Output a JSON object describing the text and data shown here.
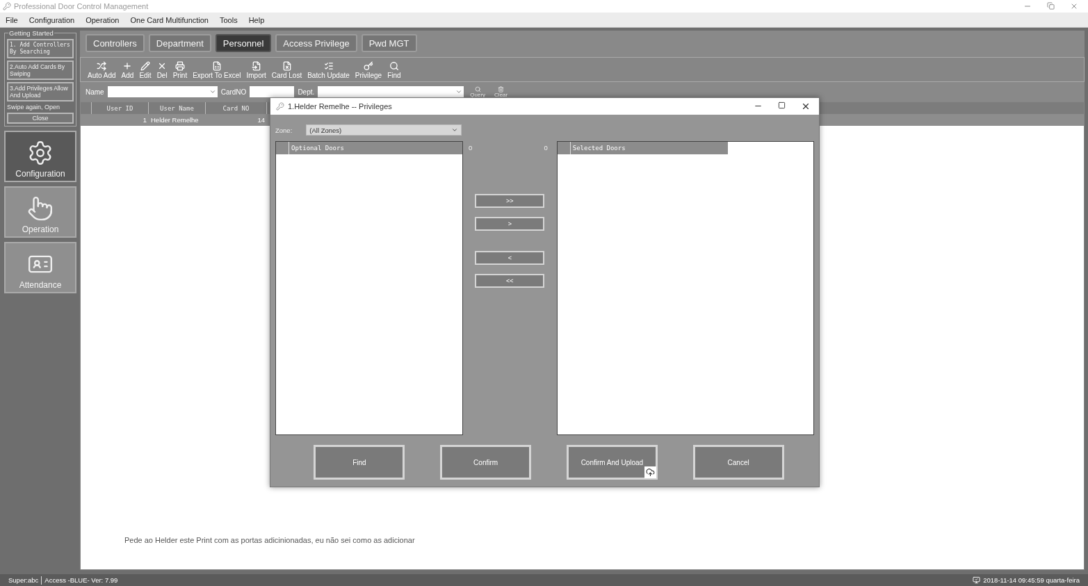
{
  "window": {
    "title": "Professional Door Control Management"
  },
  "menu": [
    "File",
    "Configuration",
    "Operation",
    "One Card Multifunction",
    "Tools",
    "Help"
  ],
  "getting_started": {
    "title": "Getting Started",
    "steps": [
      "1. Add Controllers By Searching",
      "2.Auto Add Cards By Swiping",
      "3.Add Privileges Allow And Upload"
    ],
    "note": "Swipe again, Open",
    "close": "Close"
  },
  "nav": [
    {
      "label": "Configuration",
      "kind": "gear",
      "selected": true
    },
    {
      "label": "Operation",
      "kind": "hand",
      "selected": false
    },
    {
      "label": "Attendance",
      "kind": "badge",
      "selected": false
    }
  ],
  "tabs": [
    {
      "label": "Controllers",
      "selected": false
    },
    {
      "label": "Department",
      "selected": false
    },
    {
      "label": "Personnel",
      "selected": true
    },
    {
      "label": "Access Privilege",
      "selected": false
    },
    {
      "label": "Pwd MGT",
      "selected": false
    }
  ],
  "toolbar": [
    {
      "label": "Auto Add",
      "kind": "auto"
    },
    {
      "label": "Add",
      "kind": "add"
    },
    {
      "label": "Edit",
      "kind": "edit"
    },
    {
      "label": "Del",
      "kind": "delete"
    },
    {
      "label": "Print",
      "kind": "print"
    },
    {
      "label": "Export To Excel",
      "kind": "excel"
    },
    {
      "label": "Import",
      "kind": "import"
    },
    {
      "label": "Card Lost",
      "kind": "lost"
    },
    {
      "label": "Batch Update",
      "kind": "batch"
    },
    {
      "label": "Privilege",
      "kind": "privilege"
    },
    {
      "label": "Find",
      "kind": "find"
    }
  ],
  "filter": {
    "name_label": "Name",
    "cardno_label": "CardNO",
    "dept_label": "Dept.",
    "query": "Query",
    "clear": "Clear"
  },
  "table": {
    "columns": [
      "User ID",
      "User Name",
      "Card NO"
    ],
    "rows": [
      {
        "cells": [
          "1",
          "Helder Remelhe",
          "14"
        ],
        "selected": true
      }
    ]
  },
  "note": "Pede ao Helder este Print com as portas adicinionadas, eu não sei como as adicionar",
  "dialog": {
    "title": "1.Helder Remelhe -- Privileges",
    "zone_label": "Zone:",
    "zone_value": "(All Zones)",
    "optional_header": "Optional Doors",
    "optional_count": "0",
    "selected_count": "0",
    "selected_header": "Selected Doors",
    "move_buttons": [
      ">>",
      ">",
      "<",
      "<<"
    ],
    "buttons": [
      {
        "label": "Find",
        "upload": false
      },
      {
        "label": "Confirm",
        "upload": false
      },
      {
        "label": "Confirm And Upload",
        "upload": true
      },
      {
        "label": "Cancel",
        "upload": false
      }
    ]
  },
  "status_bar": {
    "user": "Super:abc",
    "version": "Access -BLUE- Ver: 7.99",
    "datetime": "2018-11-14 09:45:59 quarta-feira"
  }
}
